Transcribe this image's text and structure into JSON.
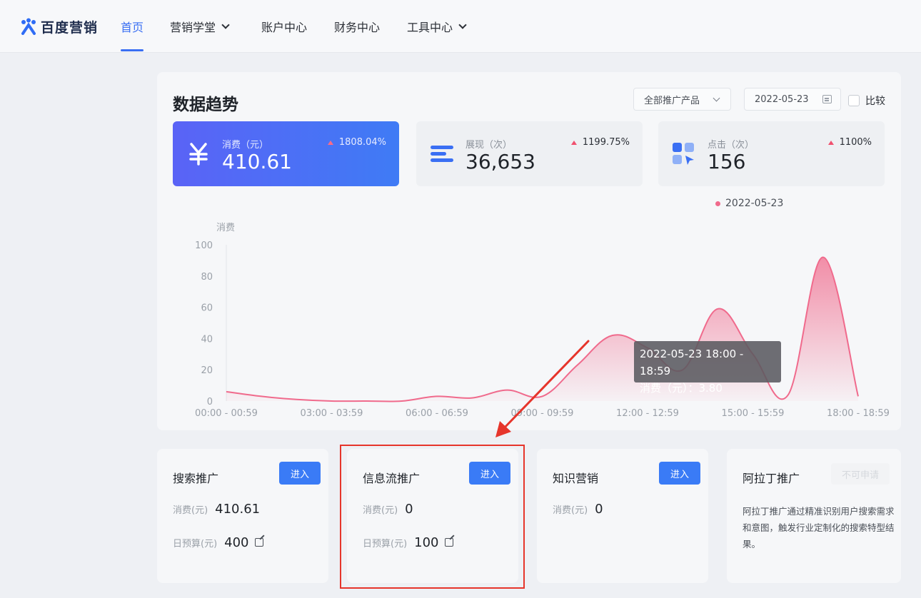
{
  "brand": {
    "name": "百度营销"
  },
  "nav": {
    "items": [
      {
        "label": "首页"
      },
      {
        "label": "营销学堂"
      },
      {
        "label": "账户中心"
      },
      {
        "label": "财务中心"
      },
      {
        "label": "工具中心"
      }
    ]
  },
  "panel": {
    "title": "数据趋势",
    "product_select": "全部推广产品",
    "date": "2022-05-23",
    "compare_label": "比较"
  },
  "metrics": [
    {
      "label": "消费（元）",
      "value": "410.61",
      "change": "1808.04%",
      "icon": "yuan-icon"
    },
    {
      "label": "展现（次）",
      "value": "36,653",
      "change": "1199.75%",
      "icon": "bars-icon"
    },
    {
      "label": "点击（次）",
      "value": "156",
      "change": "1100%",
      "icon": "click-grid-icon"
    }
  ],
  "colors": {
    "accent": "#3a7bf6",
    "series": "#f06a8c",
    "up": "#f0506e",
    "highlight": "#e6352b"
  },
  "chart_data": {
    "type": "area",
    "ylabel": "消费",
    "ylim": [
      0,
      100
    ],
    "yticks": [
      "100",
      "80",
      "60",
      "40",
      "20",
      "0"
    ],
    "xticks": [
      "00:00 - 00:59",
      "03:00 - 03:59",
      "06:00 - 06:59",
      "09:00 - 09:59",
      "12:00 - 12:59",
      "15:00 - 15:59",
      "18:00 - 18:59"
    ],
    "legend": "2022-05-23",
    "series": [
      {
        "name": "2022-05-23",
        "x": [
          0,
          1,
          2,
          3,
          4,
          5,
          6,
          7,
          8,
          9,
          10,
          11,
          12,
          13,
          14,
          15,
          16,
          17,
          18
        ],
        "values": [
          6,
          3,
          1,
          0,
          0,
          0,
          3,
          2,
          7,
          3,
          23,
          42,
          34,
          20,
          59,
          30,
          3.8,
          92,
          3
        ]
      }
    ],
    "tooltip": {
      "title": "2022-05-23 18:00 - 18:59",
      "text": "消费（元）：3.80"
    }
  },
  "cards": [
    {
      "title": "搜索推广",
      "button": "进入",
      "spend_label": "消费(元)",
      "spend": "410.61",
      "budget_label": "日预算(元)",
      "budget": "400"
    },
    {
      "title": "信息流推广",
      "button": "进入",
      "spend_label": "消费(元)",
      "spend": "0",
      "budget_label": "日预算(元)",
      "budget": "100"
    },
    {
      "title": "知识营销",
      "button": "进入",
      "spend_label": "消费(元)",
      "spend": "0"
    },
    {
      "title": "阿拉丁推广",
      "button": "不可申请",
      "desc": "阿拉丁推广通过精准识别用户搜索需求和意图，触发行业定制化的搜索特型结果。"
    }
  ]
}
